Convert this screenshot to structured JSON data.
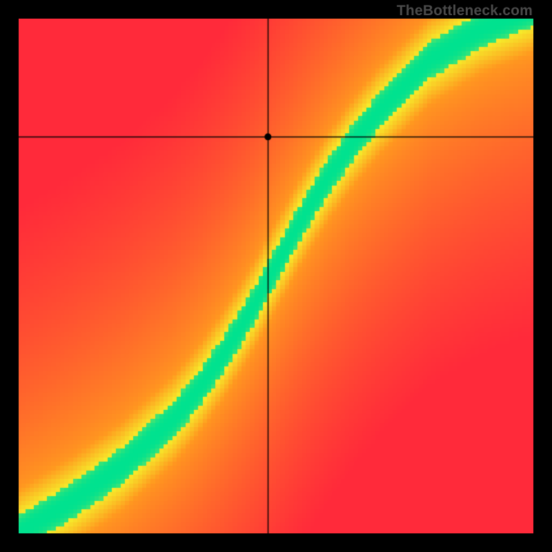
{
  "watermark": "TheBottleneck.com",
  "chart_data": {
    "type": "heatmap",
    "title": "",
    "xlabel": "",
    "ylabel": "",
    "xlim": [
      0,
      1
    ],
    "ylim": [
      0,
      1
    ],
    "crosshair": {
      "x": 0.485,
      "y": 0.77
    },
    "marker": {
      "x": 0.485,
      "y": 0.77,
      "radius": 5
    },
    "optimal_curve_comment": "Green band is the perfect-balance curve; colors fade yellow→orange→red with distance from it.",
    "optimal_curve": [
      {
        "x": 0.0,
        "y": 0.0
      },
      {
        "x": 0.1,
        "y": 0.06
      },
      {
        "x": 0.2,
        "y": 0.13
      },
      {
        "x": 0.3,
        "y": 0.22
      },
      {
        "x": 0.35,
        "y": 0.28
      },
      {
        "x": 0.4,
        "y": 0.35
      },
      {
        "x": 0.45,
        "y": 0.43
      },
      {
        "x": 0.5,
        "y": 0.52
      },
      {
        "x": 0.55,
        "y": 0.61
      },
      {
        "x": 0.6,
        "y": 0.69
      },
      {
        "x": 0.65,
        "y": 0.76
      },
      {
        "x": 0.7,
        "y": 0.82
      },
      {
        "x": 0.75,
        "y": 0.87
      },
      {
        "x": 0.8,
        "y": 0.92
      },
      {
        "x": 0.85,
        "y": 0.95
      },
      {
        "x": 0.9,
        "y": 0.98
      },
      {
        "x": 1.0,
        "y": 1.02
      }
    ],
    "green_band_halfwidth": 0.035,
    "yellow_band_halfwidth": 0.085,
    "colors": {
      "optimal": "#00e28f",
      "near": "#f6e92a",
      "mid": "#ff9a1f",
      "far": "#ff2a3a"
    }
  }
}
